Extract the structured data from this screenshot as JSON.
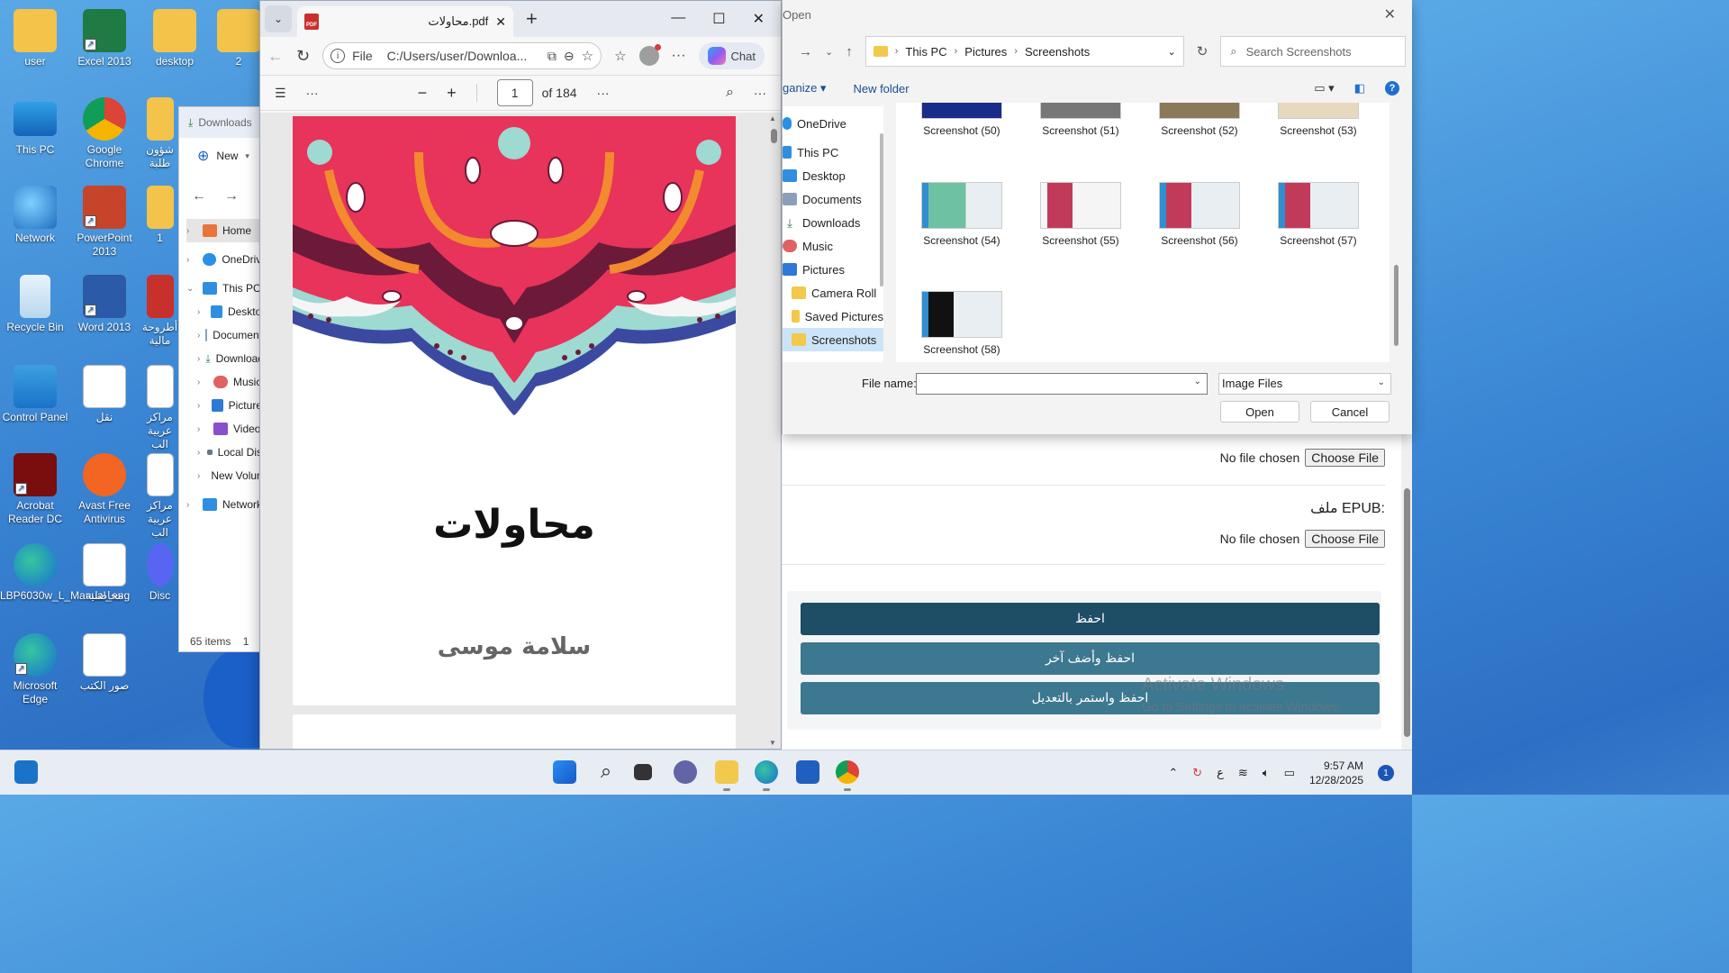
{
  "desktop": {
    "icons": [
      {
        "label": "user"
      },
      {
        "label": "Excel 2013"
      },
      {
        "label": "desktop"
      },
      {
        "label": "2"
      },
      {
        "label": "This PC"
      },
      {
        "label": "Google Chrome"
      },
      {
        "label": "شؤون طلبة"
      },
      {
        "label": "Network"
      },
      {
        "label": "PowerPoint 2013"
      },
      {
        "label": "1"
      },
      {
        "label": "Recycle Bin"
      },
      {
        "label": "Word 2013"
      },
      {
        "label": "أطروحة مالية"
      },
      {
        "label": "Control Panel"
      },
      {
        "label": "نقل"
      },
      {
        "label": "مراكز عربية الب"
      },
      {
        "label": "Acrobat Reader DC"
      },
      {
        "label": "Avast Free Antivirus"
      },
      {
        "label": "مراكز عربية الب"
      },
      {
        "label": "LBP6030w_L_Manual_eng"
      },
      {
        "label": "محاضلية"
      },
      {
        "label": "Disc"
      },
      {
        "label": "Microsoft Edge"
      },
      {
        "label": "صور الكتب"
      }
    ]
  },
  "explorer": {
    "tab_label": "Downloads",
    "new_label": "New",
    "tree": [
      {
        "label": "Home"
      },
      {
        "label": "OneDrive"
      },
      {
        "label": "This PC"
      },
      {
        "label": "Desktop"
      },
      {
        "label": "Documents"
      },
      {
        "label": "Downloads"
      },
      {
        "label": "Music"
      },
      {
        "label": "Pictures"
      },
      {
        "label": "Videos"
      },
      {
        "label": "Local Disk"
      },
      {
        "label": "New Volume"
      },
      {
        "label": "Network"
      }
    ],
    "status": "65 items",
    "status_extra": "1"
  },
  "edge": {
    "tab_title": "محاولات.pdf",
    "url_scheme": "File",
    "url": "C:/Users/user/Downloa...",
    "chat_label": "Chat",
    "pdf": {
      "page_number": "1",
      "page_total": "of 184",
      "cover_title": "محاولات",
      "cover_author": "سلامة موسى"
    }
  },
  "dialog": {
    "title": "Open",
    "breadcrumb": [
      "This PC",
      "Pictures",
      "Screenshots"
    ],
    "search_placeholder": "Search Screenshots",
    "organize_label": "ganize",
    "new_folder_label": "New folder",
    "sidebar": [
      {
        "label": "OneDrive"
      },
      {
        "label": "This PC"
      },
      {
        "label": "Desktop"
      },
      {
        "label": "Documents"
      },
      {
        "label": "Downloads"
      },
      {
        "label": "Music"
      },
      {
        "label": "Pictures"
      },
      {
        "label": "Camera Roll"
      },
      {
        "label": "Saved Pictures"
      },
      {
        "label": "Screenshots"
      }
    ],
    "files": [
      {
        "name": "Screenshot (50)"
      },
      {
        "name": "Screenshot (51)"
      },
      {
        "name": "Screenshot (52)"
      },
      {
        "name": "Screenshot (53)"
      },
      {
        "name": "Screenshot (54)"
      },
      {
        "name": "Screenshot (55)"
      },
      {
        "name": "Screenshot (56)"
      },
      {
        "name": "Screenshot (57)"
      },
      {
        "name": "Screenshot (58)"
      }
    ],
    "file_name_label": "File name:",
    "file_type": "Image Files",
    "open_label": "Open",
    "cancel_label": "Cancel"
  },
  "webpage": {
    "no_file_1": "No file chosen",
    "choose_file_1": "Choose File",
    "epub_label": "ملف EPUB:",
    "no_file_2": "No file chosen",
    "choose_file_2": "Choose File",
    "save_btn": "احفظ",
    "save_add_btn": "احفظ وأضف آخر",
    "save_continue_btn": "احفظ واستمر بالتعديل",
    "btn_colors": [
      "#1e4d66",
      "#3d7891",
      "#3d7891"
    ],
    "watermark_title": "Activate Windows",
    "watermark_sub": "Go to Settings to activate Windows."
  },
  "taskbar": {
    "lang": "ع",
    "time": "9:57 AM",
    "date": "12/28/2025",
    "notifications": "1"
  }
}
